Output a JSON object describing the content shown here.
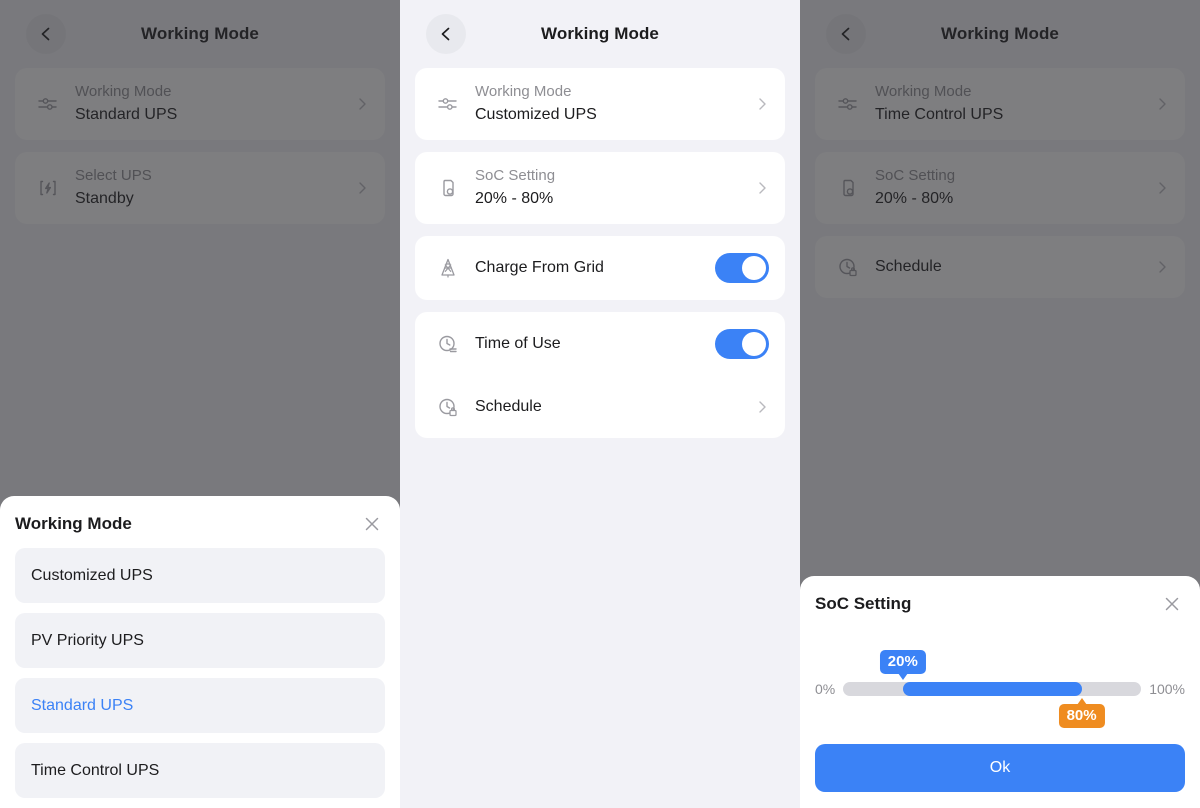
{
  "theme": {
    "accent_blue": "#3b82f6",
    "accent_orange": "#ef8c20",
    "page_bg": "#f2f2f7",
    "card_bg": "#ffffff",
    "label_gray": "#8e8e93",
    "text_dark": "#1c1c1e"
  },
  "panel1": {
    "header": {
      "title": "Working Mode",
      "back_icon": "chevron-left-icon"
    },
    "rows": [
      {
        "icon": "sliders-icon",
        "label": "Working Mode",
        "value": "Standard UPS",
        "chevron": true
      },
      {
        "icon": "ups-bolt-icon",
        "label": "Select UPS",
        "value": "Standby",
        "chevron": true
      }
    ],
    "sheet": {
      "title": "Working Mode",
      "close_icon": "close-icon",
      "options": [
        {
          "label": "Customized UPS",
          "selected": false
        },
        {
          "label": "PV Priority UPS",
          "selected": false
        },
        {
          "label": "Standard UPS",
          "selected": true
        },
        {
          "label": "Time Control UPS",
          "selected": false
        }
      ]
    }
  },
  "panel2": {
    "header": {
      "title": "Working Mode",
      "back_icon": "chevron-left-icon"
    },
    "rows": [
      {
        "icon": "sliders-icon",
        "label": "Working Mode",
        "value": "Customized UPS",
        "type": "nav"
      },
      {
        "icon": "battery-tag-icon",
        "label": "SoC Setting",
        "value": "20% - 80%",
        "type": "nav"
      },
      {
        "icon": "grid-tower-icon",
        "title": "Charge From Grid",
        "type": "toggle",
        "on": true
      },
      {
        "icon": "clock-lines-icon",
        "title": "Time of Use",
        "type": "toggle",
        "on": true
      },
      {
        "icon": "clock-schedule-icon",
        "title": "Schedule",
        "type": "nav-single"
      }
    ]
  },
  "panel3": {
    "header": {
      "title": "Working Mode",
      "back_icon": "chevron-left-icon"
    },
    "rows": [
      {
        "icon": "sliders-icon",
        "label": "Working Mode",
        "value": "Time Control UPS",
        "type": "nav"
      },
      {
        "icon": "battery-tag-icon",
        "label": "SoC Setting",
        "value": "20% - 80%",
        "type": "nav"
      },
      {
        "icon": "clock-schedule-icon",
        "title": "Schedule",
        "type": "nav-single"
      }
    ],
    "soc_dialog": {
      "title": "SoC Setting",
      "close_icon": "close-icon",
      "min_label": "0%",
      "max_label": "100%",
      "low_value_label": "20%",
      "high_value_label": "80%",
      "low_value": 20,
      "high_value": 80,
      "range_min": 0,
      "range_max": 100,
      "ok_label": "Ok"
    }
  }
}
